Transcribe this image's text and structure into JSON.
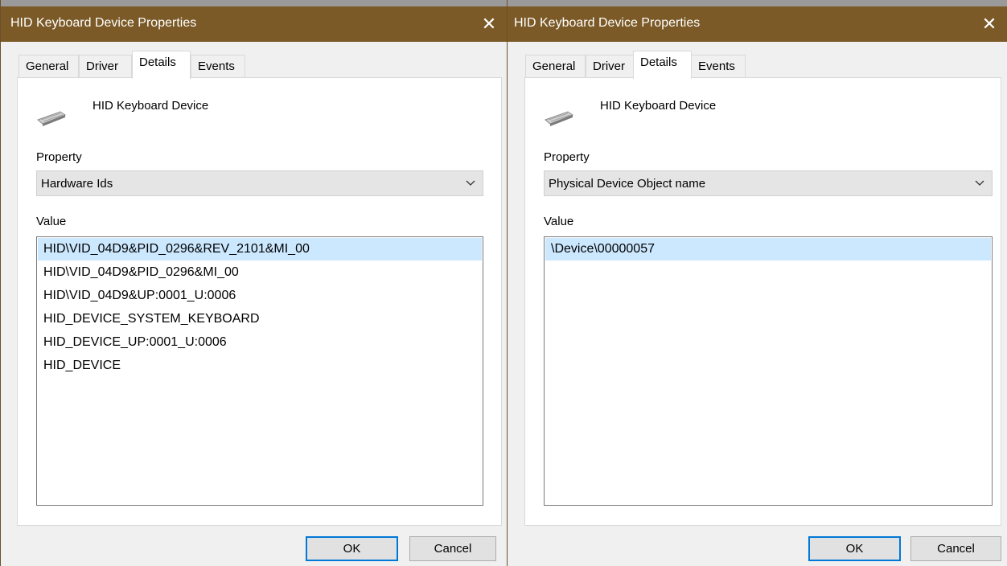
{
  "dialogs": [
    {
      "title": "HID Keyboard Device Properties",
      "close_glyph": "✕",
      "tabs": [
        "General",
        "Driver",
        "Details",
        "Events"
      ],
      "active_tab": "Details",
      "device_name": "HID Keyboard Device",
      "device_icon": "keyboard-icon",
      "property_label": "Property",
      "property_selected": "Hardware Ids",
      "value_label": "Value",
      "values": [
        "HID\\VID_04D9&PID_0296&REV_2101&MI_00",
        "HID\\VID_04D9&PID_0296&MI_00",
        "HID\\VID_04D9&UP:0001_U:0006",
        "HID_DEVICE_SYSTEM_KEYBOARD",
        "HID_DEVICE_UP:0001_U:0006",
        "HID_DEVICE"
      ],
      "ok_label": "OK",
      "cancel_label": "Cancel"
    },
    {
      "title": "HID Keyboard Device Properties",
      "close_glyph": "✕",
      "tabs": [
        "General",
        "Driver",
        "Details",
        "Events"
      ],
      "active_tab": "Details",
      "device_name": "HID Keyboard Device",
      "device_icon": "keyboard-icon",
      "property_label": "Property",
      "property_selected": "Physical Device Object name",
      "value_label": "Value",
      "values": [
        "\\Device\\00000057"
      ],
      "ok_label": "OK",
      "cancel_label": "Cancel"
    }
  ],
  "colors": {
    "titlebar": "#7b5a27",
    "selection": "#cce8ff",
    "ok_border": "#0078d7"
  }
}
